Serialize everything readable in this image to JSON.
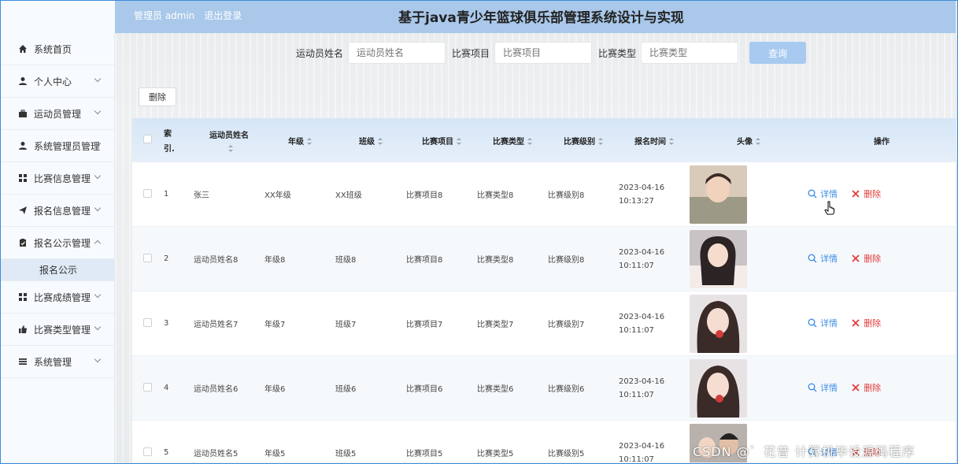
{
  "header": {
    "user_label": "管理员 admin",
    "logout_label": "退出登录",
    "title": "基于java青少年篮球俱乐部管理系统设计与实现"
  },
  "sidebar": {
    "items": [
      {
        "label": "系统首页",
        "icon": "home-icon",
        "expandable": false
      },
      {
        "label": "个人中心",
        "icon": "user-icon",
        "expandable": true
      },
      {
        "label": "运动员管理",
        "icon": "briefcase-icon",
        "expandable": true
      },
      {
        "label": "系统管理员管理",
        "icon": "user-icon",
        "expandable": true
      },
      {
        "label": "比赛信息管理",
        "icon": "grid-icon",
        "expandable": true
      },
      {
        "label": "报名信息管理",
        "icon": "send-icon",
        "expandable": true
      },
      {
        "label": "报名公示管理",
        "icon": "clipboard-icon",
        "expandable": true,
        "expanded": true
      },
      {
        "label": "比赛成绩管理",
        "icon": "grid-icon",
        "expandable": true
      },
      {
        "label": "比赛类型管理",
        "icon": "thumbs-up-icon",
        "expandable": true
      },
      {
        "label": "系统管理",
        "icon": "list-icon",
        "expandable": true
      }
    ],
    "submenu": {
      "label": "报名公示"
    }
  },
  "search": {
    "fields": [
      {
        "label": "运动员姓名",
        "placeholder": "运动员姓名"
      },
      {
        "label": "比赛项目",
        "placeholder": "比赛项目"
      },
      {
        "label": "比赛类型",
        "placeholder": "比赛类型"
      }
    ],
    "query_label": "查询"
  },
  "toolbar": {
    "delete_label": "删除"
  },
  "table": {
    "headers": {
      "index_top": "索",
      "index_bottom": "引.",
      "name": "运动员姓名",
      "grade": "年级",
      "class": "班级",
      "project": "比赛项目",
      "type": "比赛类型",
      "level": "比赛级别",
      "time": "报名时间",
      "avatar": "头像",
      "ops": "操作"
    },
    "detail_label": "详情",
    "delete_label": "删除",
    "rows": [
      {
        "index": "1",
        "name": "张三",
        "grade": "XX年级",
        "class": "XX班级",
        "project": "比赛项目8",
        "type": "比赛类型8",
        "level": "比赛级别8",
        "date": "2023-04-16",
        "time": "10:13:27"
      },
      {
        "index": "2",
        "name": "运动员姓名8",
        "grade": "年级8",
        "class": "班级8",
        "project": "比赛项目8",
        "type": "比赛类型8",
        "level": "比赛级别8",
        "date": "2023-04-16",
        "time": "10:11:07"
      },
      {
        "index": "3",
        "name": "运动员姓名7",
        "grade": "年级7",
        "class": "班级7",
        "project": "比赛项目7",
        "type": "比赛类型7",
        "level": "比赛级别7",
        "date": "2023-04-16",
        "time": "10:11:07"
      },
      {
        "index": "4",
        "name": "运动员姓名6",
        "grade": "年级6",
        "class": "班级6",
        "project": "比赛项目6",
        "type": "比赛类型6",
        "level": "比赛级别6",
        "date": "2023-04-16",
        "time": "10:11:07"
      },
      {
        "index": "5",
        "name": "运动员姓名5",
        "grade": "年级5",
        "class": "班级5",
        "project": "比赛项目5",
        "type": "比赛类型5",
        "level": "比赛级别5",
        "date": "2023-04-16",
        "time": "10:11:07"
      }
    ]
  },
  "watermark": "CSDN @゛花昔  计算机毕设源码程序",
  "colors": {
    "header_bg": "#a9c8ea",
    "detail": "#3e8ee6",
    "delete": "#e23d3d",
    "query_button": "#a8caf0"
  }
}
